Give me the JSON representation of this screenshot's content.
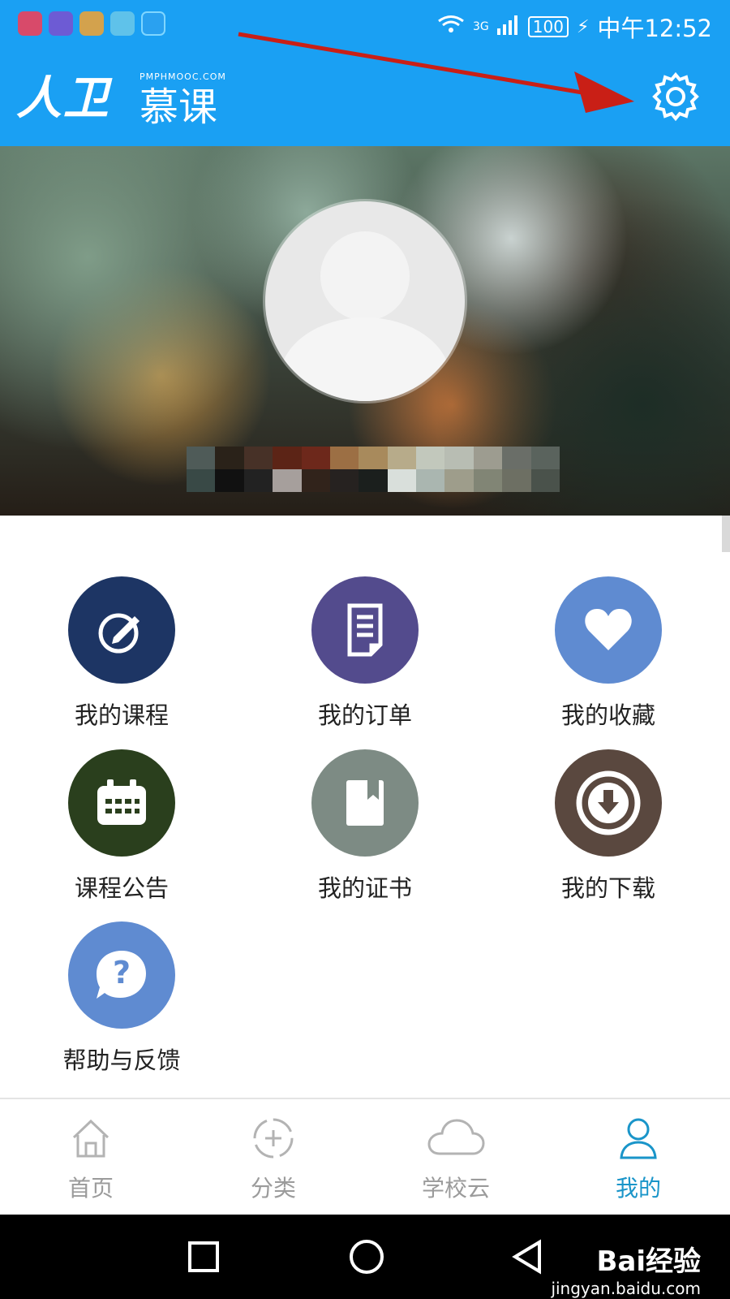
{
  "status_bar": {
    "network": "3G",
    "battery": "100",
    "time": "中午12:52",
    "app_icons": [
      "app-icon-1",
      "app-icon-2",
      "app-icon-3",
      "app-icon-4",
      "app-icon-5"
    ]
  },
  "header": {
    "logo_main": "人卫",
    "logo_sub": "慕课",
    "logo_domain": "PMPHMOOC.COM",
    "settings_icon": "gear-icon"
  },
  "profile": {
    "avatar": "default-user-avatar"
  },
  "menu": {
    "items": [
      {
        "label": "我的课程",
        "icon": "edit-icon",
        "color": "#1d3564"
      },
      {
        "label": "我的订单",
        "icon": "document-icon",
        "color": "#534b8d"
      },
      {
        "label": "我的收藏",
        "icon": "heart-icon",
        "color": "#5f8bd1"
      },
      {
        "label": "课程公告",
        "icon": "calendar-icon",
        "color": "#2a3f1d"
      },
      {
        "label": "我的证书",
        "icon": "book-icon",
        "color": "#7d8b84"
      },
      {
        "label": "我的下载",
        "icon": "download-icon",
        "color": "#5a483f"
      },
      {
        "label": "帮助与反馈",
        "icon": "help-icon",
        "color": "#5f8bd1"
      }
    ]
  },
  "tabs": [
    {
      "label": "首页",
      "icon": "home-icon",
      "active": false
    },
    {
      "label": "分类",
      "icon": "category-icon",
      "active": false
    },
    {
      "label": "学校云",
      "icon": "cloud-icon",
      "active": false
    },
    {
      "label": "我的",
      "icon": "user-icon",
      "active": true
    }
  ],
  "watermark": {
    "brand": "Bai经验",
    "domain": "jingyan.baidu.com"
  },
  "colors": {
    "primary_blue": "#1aa0f3",
    "active_tab": "#1a95c9",
    "annotation_red": "#c91f16"
  }
}
